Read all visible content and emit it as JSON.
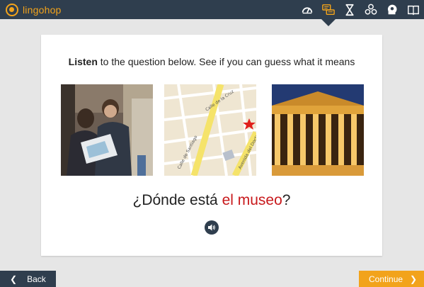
{
  "app": {
    "name": "lingohop",
    "brand_color": "#f2a31b",
    "bar_color": "#2f3e4e"
  },
  "nav": {
    "icons": [
      "dashboard-icon",
      "chat-icon",
      "hourglass-icon",
      "cubes-icon",
      "head-icon",
      "book-icon"
    ],
    "active": "chat-icon"
  },
  "lesson": {
    "instruction_bold": "Listen",
    "instruction_rest": " to the question below. See if you can guess what it means",
    "question_prefix": "¿Dónde está ",
    "question_highlight": "el museo",
    "question_suffix": "?",
    "highlight_color": "#c8191c",
    "map_streets": [
      "Calle de la Cruz",
      "Calle de Santiago",
      "Avenida del Doctor"
    ]
  },
  "buttons": {
    "back": "Back",
    "continue": "Continue"
  }
}
